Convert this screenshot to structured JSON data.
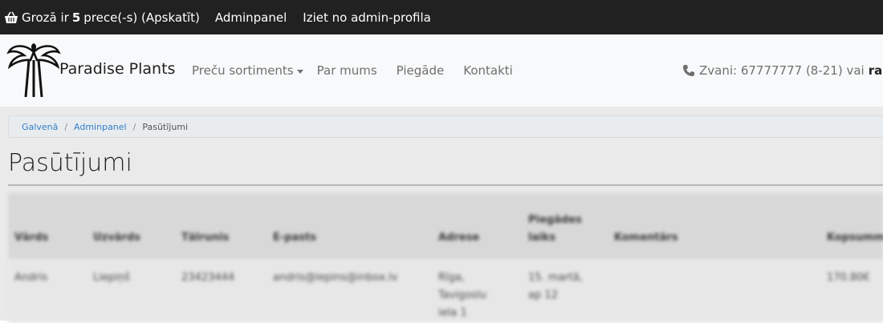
{
  "topbar": {
    "cart_prefix": "Grozā ir",
    "cart_count": "5",
    "cart_suffix": "prece(-s) (Apskatīt)",
    "admin_link": "Adminpanel",
    "logout_link": "Iziet no admin-profila",
    "icon": "basket-icon"
  },
  "navbar": {
    "brand": "Paradise Plants",
    "links": {
      "assortment": "Preču sortiments",
      "about": "Par mums",
      "shipping": "Piegāde",
      "contacts": "Kontakti"
    },
    "phone_text": "Zvani: 67777777 (8-21) vai",
    "phone_strong": "raksti",
    "icons": [
      "palm-logo-icon",
      "phone-icon",
      "caret-down-icon"
    ]
  },
  "breadcrumb": {
    "home": "Galvenā",
    "admin": "Adminpanel",
    "current": "Pasūtījumi"
  },
  "page": {
    "title": "Pasūtījumi"
  },
  "table": {
    "headers": {
      "name": "Vārds",
      "surname": "Uzvārds",
      "phone": "Tālrunis",
      "email": "E-pasts",
      "address": "Adrese",
      "delivery_l1": "Piegādes",
      "delivery_l2": "laiks",
      "comment": "Komentārs",
      "total": "Kopsumma"
    },
    "row": {
      "name": "Andris",
      "surname": "Liepiņš",
      "phone": "23423444",
      "email": "andris@lepins@inbox.lv",
      "address_l1": "Rīga,",
      "address_l2": "Tavigoslu",
      "address_l3": "iela 1",
      "delivery_l1": "15. martā,",
      "delivery_l2": "ap 12",
      "comment": "",
      "total": "170.80€"
    }
  },
  "colors": {
    "topbar_bg": "#212121",
    "navbar_bg": "#f8f9fa",
    "link_blue": "#2f7ec6",
    "content_bg": "#eaeaea"
  }
}
